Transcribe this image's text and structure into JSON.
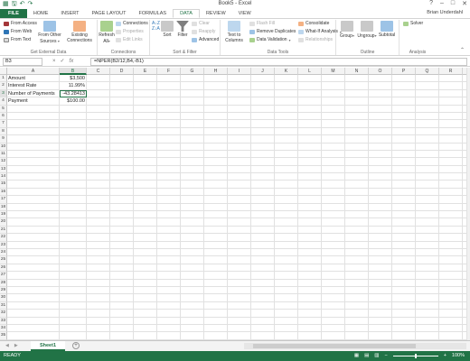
{
  "title": "Book5 - Excel",
  "user": "Brian Underdahl",
  "tabs": [
    "FILE",
    "HOME",
    "INSERT",
    "PAGE LAYOUT",
    "FORMULAS",
    "DATA",
    "REVIEW",
    "VIEW"
  ],
  "active_tab": "DATA",
  "ribbon": {
    "get_external": {
      "name": "Get External Data",
      "from_access": "From Access",
      "from_web": "From Web",
      "from_text": "From Text",
      "from_other_l1": "From Other",
      "from_other_l2": "Sources",
      "existing_l1": "Existing",
      "existing_l2": "Connections"
    },
    "connections": {
      "name": "Connections",
      "refresh_l1": "Refresh",
      "refresh_l2": "All",
      "connections": "Connections",
      "properties": "Properties",
      "edit_links": "Edit Links"
    },
    "sort_filter": {
      "name": "Sort & Filter",
      "sort": "Sort",
      "filter": "Filter",
      "clear": "Clear",
      "reapply": "Reapply",
      "advanced": "Advanced"
    },
    "data_tools": {
      "name": "Data Tools",
      "text_to_l1": "Text to",
      "text_to_l2": "Columns",
      "flash_fill": "Flash Fill",
      "remove_duplicates": "Remove Duplicates",
      "data_validation": "Data Validation",
      "consolidate": "Consolidate",
      "what_if": "What-If Analysis",
      "relationships": "Relationships"
    },
    "outline": {
      "name": "Outline",
      "group": "Group",
      "ungroup": "Ungroup",
      "subtotal": "Subtotal"
    },
    "analysis": {
      "name": "Analysis",
      "solver": "Solver"
    }
  },
  "formula_bar": {
    "name_box": "B3",
    "cancel": "×",
    "enter": "✓",
    "fx": "fx",
    "formula": "=NPER(B2/12,B4,-B1)"
  },
  "columns": [
    "A",
    "B",
    "C",
    "D",
    "E",
    "F",
    "G",
    "H",
    "I",
    "J",
    "K",
    "L",
    "M",
    "N",
    "O",
    "P",
    "Q",
    "R",
    "S"
  ],
  "selected_column": "B",
  "selected_row": 3,
  "row_count": 36,
  "cells": [
    {
      "row": 1,
      "a": "Amount",
      "b": "$3,500"
    },
    {
      "row": 2,
      "a": "Interest Rate",
      "b": "11.99%"
    },
    {
      "row": 3,
      "a": "Number of Payments",
      "b": "-43.28413"
    },
    {
      "row": 4,
      "a": "Payment",
      "b": "$100.00"
    }
  ],
  "sheet_tab": "Sheet1",
  "status": {
    "ready": "READY",
    "zoom": "100%",
    "minus": "−",
    "plus": "+"
  }
}
